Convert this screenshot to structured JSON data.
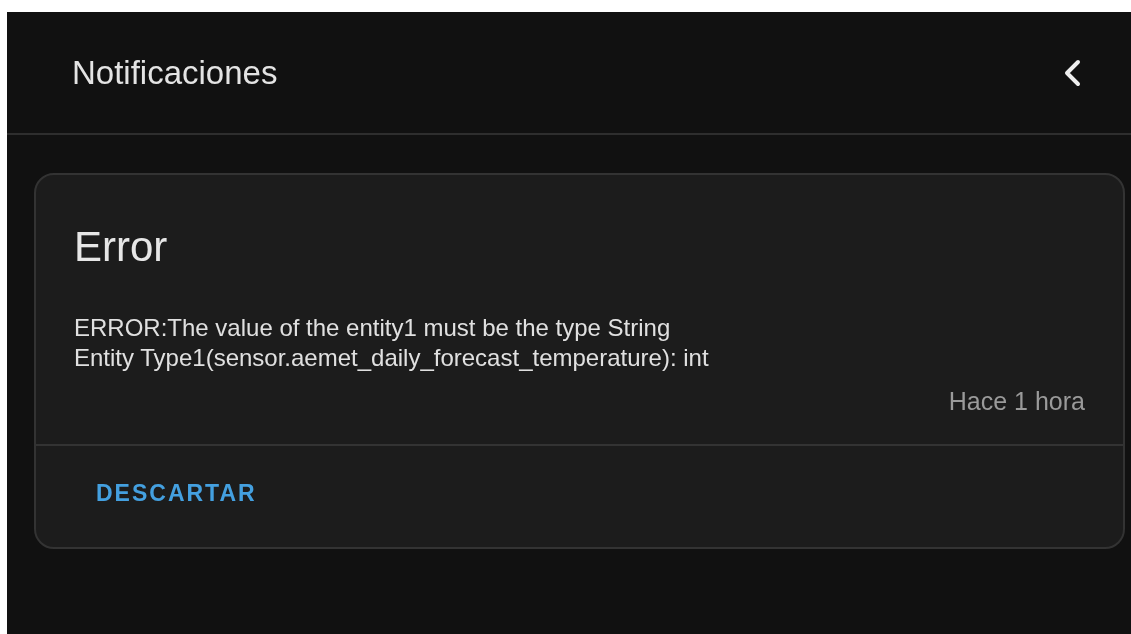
{
  "header": {
    "title": "Notificaciones"
  },
  "notifications": [
    {
      "title": "Error",
      "message": "ERROR:The value of the entity1 must be the type String\nEntity Type1(sensor.aemet_daily_forecast_temperature): int",
      "time": "Hace 1 hora",
      "actions": [
        "DESCARTAR"
      ]
    }
  ]
}
